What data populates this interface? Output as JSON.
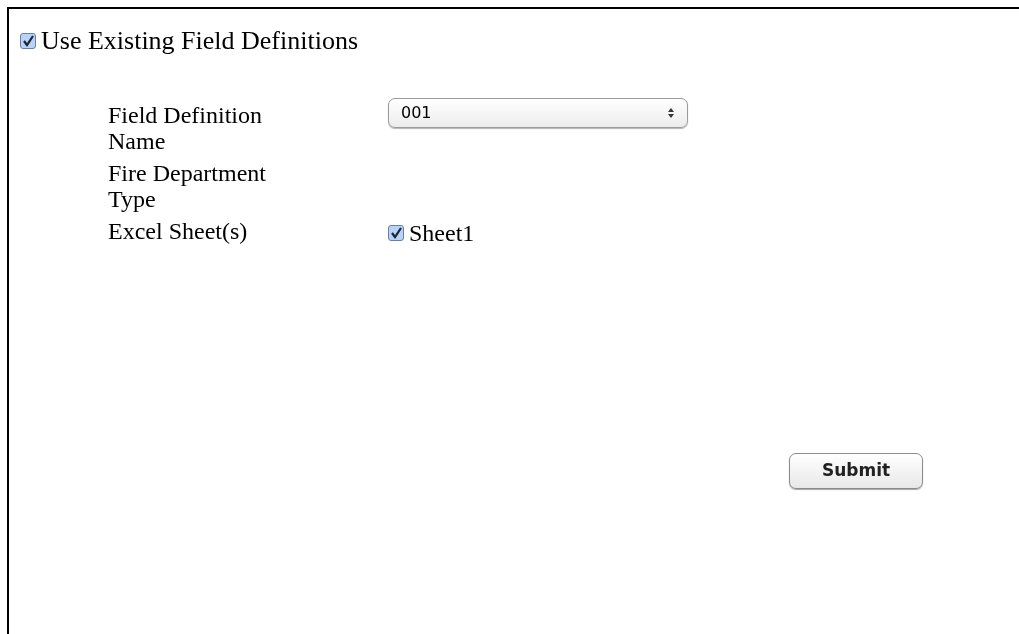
{
  "use_existing": {
    "label": "Use Existing Field Definitions",
    "checked": true
  },
  "fields": [
    {
      "kind": "select",
      "label": "Field Definition Name",
      "value": "001"
    },
    {
      "kind": "empty",
      "label": "Fire Department Type"
    },
    {
      "kind": "checkboxes",
      "label": "Excel Sheet(s)",
      "options": [
        {
          "label": "Sheet1",
          "checked": true
        }
      ]
    }
  ],
  "submit": {
    "label": "Submit"
  }
}
